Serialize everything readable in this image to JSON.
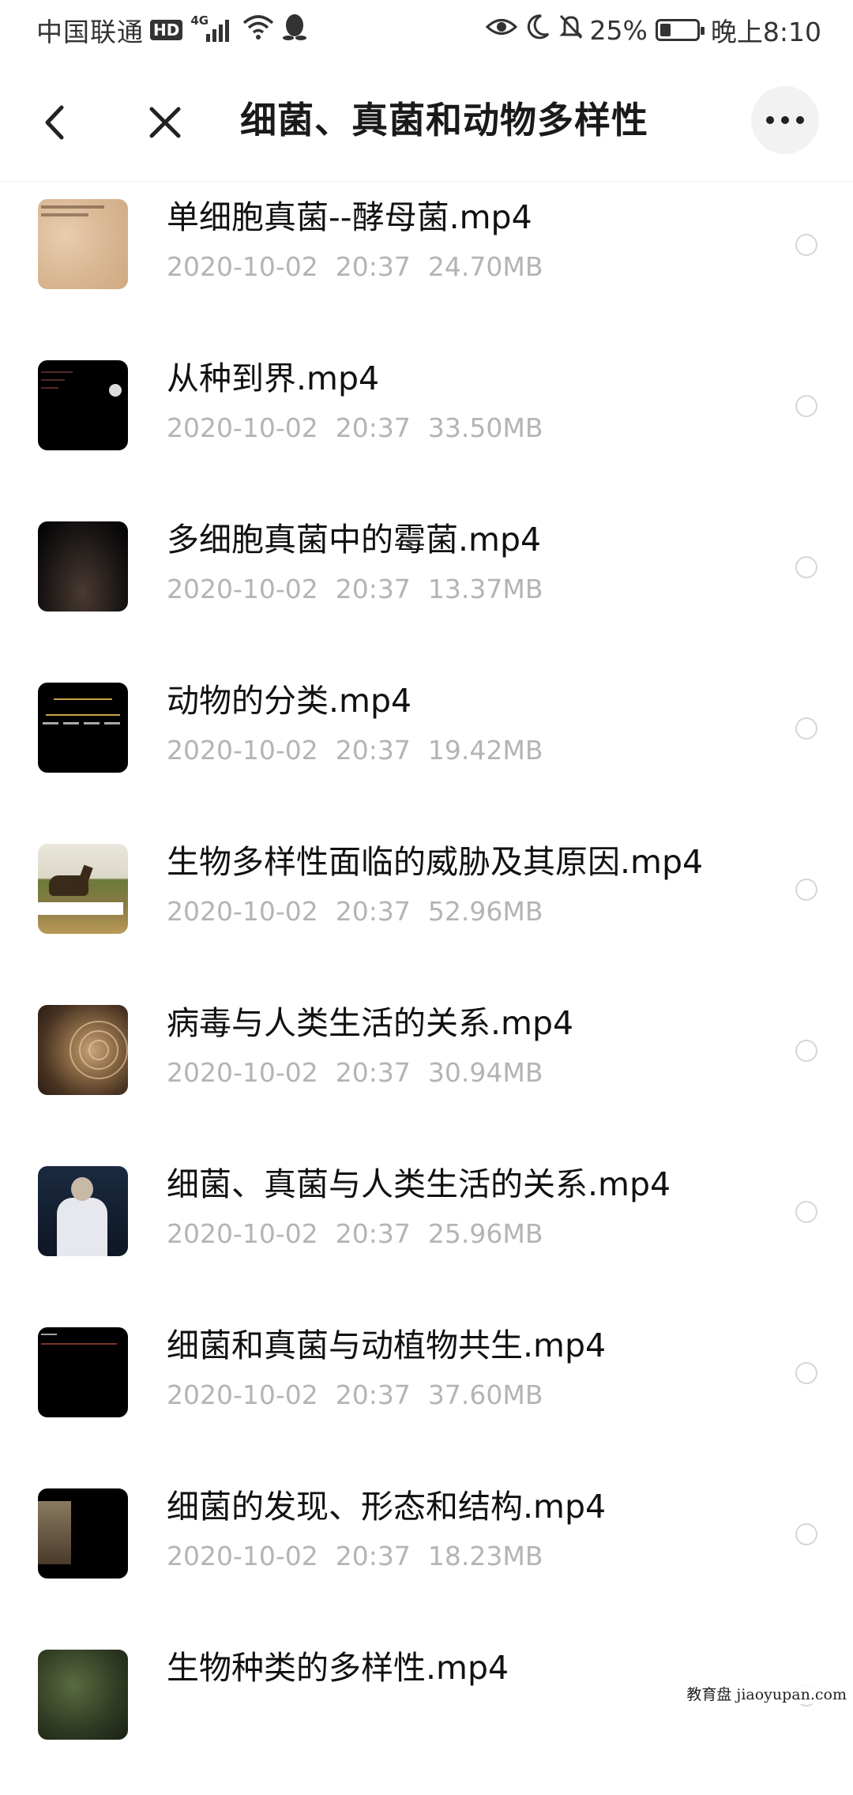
{
  "status_bar": {
    "carrier": "中国联通",
    "hd": "HD",
    "network": "4G",
    "battery": "25%",
    "time": "晚上8:10"
  },
  "nav": {
    "title": "细菌、真菌和动物多样性"
  },
  "files": [
    {
      "name": "单细胞真菌--酵母菌.mp4",
      "date": "2020-10-02",
      "time": "20:37",
      "size": "24.70MB"
    },
    {
      "name": "从种到界.mp4",
      "date": "2020-10-02",
      "time": "20:37",
      "size": "33.50MB"
    },
    {
      "name": "多细胞真菌中的霉菌.mp4",
      "date": "2020-10-02",
      "time": "20:37",
      "size": "13.37MB"
    },
    {
      "name": "动物的分类.mp4",
      "date": "2020-10-02",
      "time": "20:37",
      "size": "19.42MB"
    },
    {
      "name": "生物多样性面临的威胁及其原因.mp4",
      "date": "2020-10-02",
      "time": "20:37",
      "size": "52.96MB"
    },
    {
      "name": "病毒与人类生活的关系.mp4",
      "date": "2020-10-02",
      "time": "20:37",
      "size": "30.94MB"
    },
    {
      "name": "细菌、真菌与人类生活的关系.mp4",
      "date": "2020-10-02",
      "time": "20:37",
      "size": "25.96MB"
    },
    {
      "name": "细菌和真菌与动植物共生.mp4",
      "date": "2020-10-02",
      "time": "20:37",
      "size": "37.60MB"
    },
    {
      "name": "细菌的发现、形态和结构.mp4",
      "date": "2020-10-02",
      "time": "20:37",
      "size": "18.23MB"
    },
    {
      "name": "生物种类的多样性.mp4",
      "date": "",
      "time": "",
      "size": ""
    }
  ],
  "watermark": "教育盘 jiaoyupan.com",
  "colors": {
    "title_text": "#1a1a1a",
    "file_name": "#111111",
    "meta_text": "#b4b4b4",
    "more_button_bg": "#f2f2f2"
  },
  "icons": {
    "back": "chevron-left-icon",
    "close": "close-icon",
    "more": "more-horizontal-icon"
  }
}
